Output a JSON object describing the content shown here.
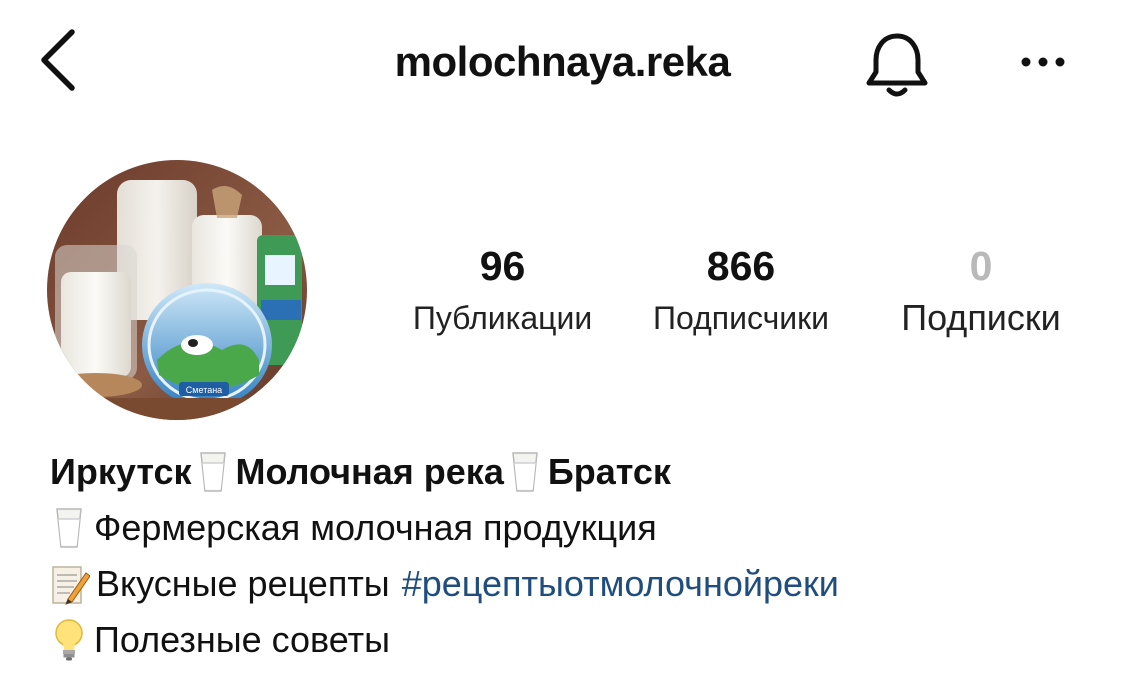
{
  "header": {
    "username": "molochnaya.reka",
    "back_icon": "chevron-left-icon",
    "bell_icon": "bell-icon",
    "more_icon": "more-horizontal-icon"
  },
  "profile": {
    "avatar_icon": "profile-avatar-milk-products-photo",
    "avatar_photo_text": "Сметана",
    "stats": {
      "posts": {
        "value": "96",
        "label": "Публикации"
      },
      "followers": {
        "value": "866",
        "label": "Подписчики"
      },
      "following": {
        "value": "0",
        "label": "Подписки"
      }
    }
  },
  "bio": {
    "name_parts": [
      "Иркутск",
      "Молочная река",
      "Братск"
    ],
    "line1_text": "Фермерская молочная продукция",
    "line2_text": "Вкусные рецепты",
    "line2_hashtag": "#рецептыотмолочнойреки",
    "line3_text": "Полезные советы",
    "icons": {
      "milk": "milk-glass-icon",
      "memo": "memo-pencil-icon",
      "bulb": "light-bulb-icon"
    }
  },
  "colors": {
    "text": "#111111",
    "muted_count": "#b9b9b9",
    "hashtag": "#1f4d7e"
  }
}
